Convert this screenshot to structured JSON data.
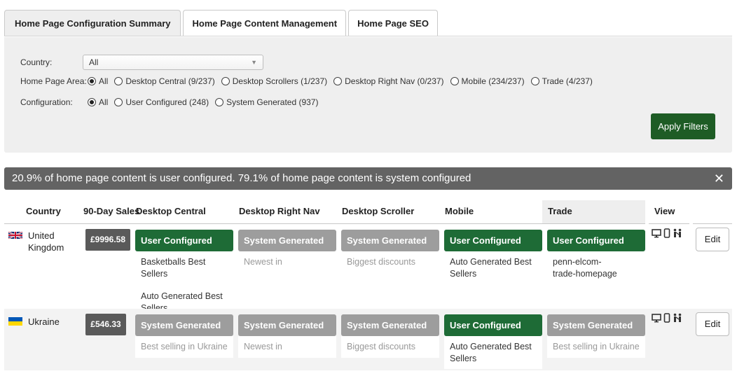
{
  "tabs": [
    {
      "label": "Home Page Configuration Summary",
      "active": true
    },
    {
      "label": "Home Page Content Management",
      "active": false
    },
    {
      "label": "Home Page SEO",
      "active": false
    }
  ],
  "filters": {
    "country": {
      "label": "Country:",
      "value": "All"
    },
    "home_page_area": {
      "label": "Home Page Area:",
      "options": [
        {
          "label": "All",
          "selected": true
        },
        {
          "label": "Desktop Central (9/237)",
          "selected": false
        },
        {
          "label": "Desktop Scrollers (1/237)",
          "selected": false
        },
        {
          "label": "Desktop Right Nav (0/237)",
          "selected": false
        },
        {
          "label": "Mobile (234/237)",
          "selected": false
        },
        {
          "label": "Trade (4/237)",
          "selected": false
        }
      ]
    },
    "configuration": {
      "label": "Configuration:",
      "options": [
        {
          "label": "All",
          "selected": true
        },
        {
          "label": "User Configured (248)",
          "selected": false
        },
        {
          "label": "System Generated (937)",
          "selected": false
        }
      ]
    },
    "apply_label": "Apply Filters"
  },
  "banner": {
    "text": "20.9% of home page content is user configured. 79.1% of home page content is system configured",
    "close_icon": "close-icon"
  },
  "table": {
    "headers": {
      "country": "Country",
      "sales": "90-Day Sales",
      "desktop_central": "Desktop Central",
      "desktop_right_nav": "Desktop Right Nav",
      "desktop_scroller": "Desktop Scroller",
      "mobile": "Mobile",
      "trade": "Trade",
      "view": "View"
    },
    "rows": [
      {
        "country": "United Kingdom",
        "flag": "uk-flag",
        "sales": "£9996.58",
        "desktop_central": {
          "status": "User Configured",
          "items": [
            "Basketballs Best Sellers",
            "Auto Generated Best Sellers"
          ]
        },
        "desktop_right_nav": {
          "status": "System Generated",
          "items": [
            "Newest in"
          ]
        },
        "desktop_scroller": {
          "status": "System Generated",
          "items": [
            "Biggest discounts"
          ]
        },
        "mobile": {
          "status": "User Configured",
          "items": [
            "Auto Generated Best Sellers"
          ]
        },
        "trade": {
          "status": "User Configured",
          "items": [
            "penn-elcom-trade-homepage"
          ]
        },
        "view_icons": [
          "desktop-icon",
          "mobile-icon",
          "trade-icon"
        ],
        "edit_label": "Edit"
      },
      {
        "country": "Ukraine",
        "flag": "ukraine-flag",
        "sales": "£546.33",
        "desktop_central": {
          "status": "System Generated",
          "items": [
            "Best selling in Ukraine"
          ]
        },
        "desktop_right_nav": {
          "status": "System Generated",
          "items": [
            "Newest in"
          ]
        },
        "desktop_scroller": {
          "status": "System Generated",
          "items": [
            "Biggest discounts"
          ]
        },
        "mobile": {
          "status": "User Configured",
          "items": [
            "Auto Generated Best Sellers"
          ]
        },
        "trade": {
          "status": "System Generated",
          "items": [
            "Best selling in Ukraine"
          ]
        },
        "view_icons": [
          "desktop-icon",
          "mobile-icon",
          "trade-icon"
        ],
        "edit_label": "Edit"
      }
    ]
  },
  "colors": {
    "user_configured": "#1e6b36",
    "system_generated": "#9d9d9d",
    "apply_button": "#1e5c25",
    "banner": "#636363"
  }
}
